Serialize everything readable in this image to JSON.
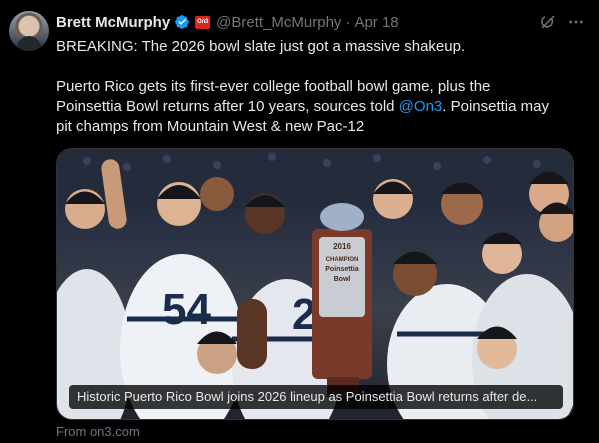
{
  "tweet": {
    "author_name": "Brett McMurphy",
    "affiliation_badge": "On3",
    "handle": "@Brett_McMurphy",
    "separator": "·",
    "date": "Apr 18",
    "text_line1": "BREAKING: The 2026 bowl slate just got a massive shakeup.",
    "text_line2_a": "Puerto Rico gets its first-ever college football bowl game, plus the",
    "text_line2_b": "Poinsettia Bowl returns after 10 years, sources told ",
    "mention": "@On3",
    "text_line2_c": ". Poinsettia may",
    "text_line3": "pit champs from Mountain West & new Pac-12"
  },
  "media": {
    "caption": "Historic Puerto Rico Bowl joins 2026 lineup as Poinsettia Bowl returns after de...",
    "trophy_year": "2016",
    "trophy_line1": "CHAMPION",
    "trophy_line2": "Poinsettia",
    "trophy_line3": "Bowl",
    "jersey_1": "54",
    "jersey_2": "2"
  },
  "link_source": "From on3.com",
  "icons": {
    "verified": "verified-badge-icon",
    "grok": "grok-icon",
    "more": "more-icon"
  },
  "colors": {
    "background": "#000000",
    "text": "#e7e9ea",
    "muted": "#71767b",
    "link": "#1d9bf0",
    "verified": "#1d9bf0",
    "affiliation": "#e2231a"
  }
}
